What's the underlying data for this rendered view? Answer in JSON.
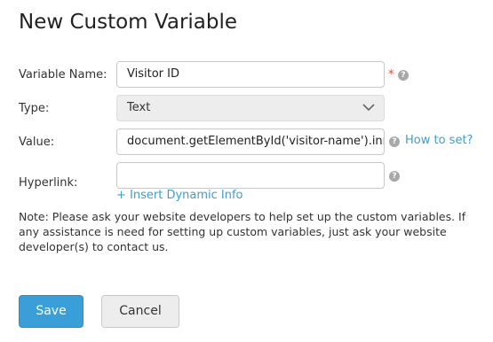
{
  "title": "New Custom Variable",
  "form": {
    "name_label": "Variable Name:",
    "name_value": "Visitor ID",
    "required_mark": "*",
    "type_label": "Type:",
    "type_value": "Text",
    "value_label": "Value:",
    "value_value": "document.getElementById('visitor-name').innerHTML",
    "how_to_set": "How to set?",
    "hyperlink_label": "Hyperlink:",
    "hyperlink_value": "",
    "insert_dynamic": "+ Insert Dynamic Info",
    "help_glyph": "?"
  },
  "note": "Note: Please ask your website developers to help set up the custom variables. If any assistance is need for setting up custom variables, just ask your website developer(s) to contact us.",
  "buttons": {
    "save": "Save",
    "cancel": "Cancel"
  },
  "colors": {
    "primary": "#3a9fd8",
    "link": "#3a9fd0",
    "required": "#e0463a",
    "help_icon": "#a8a8a8"
  },
  "icons": {
    "help": "question-circle-icon",
    "dropdown": "chevron-down-icon"
  }
}
